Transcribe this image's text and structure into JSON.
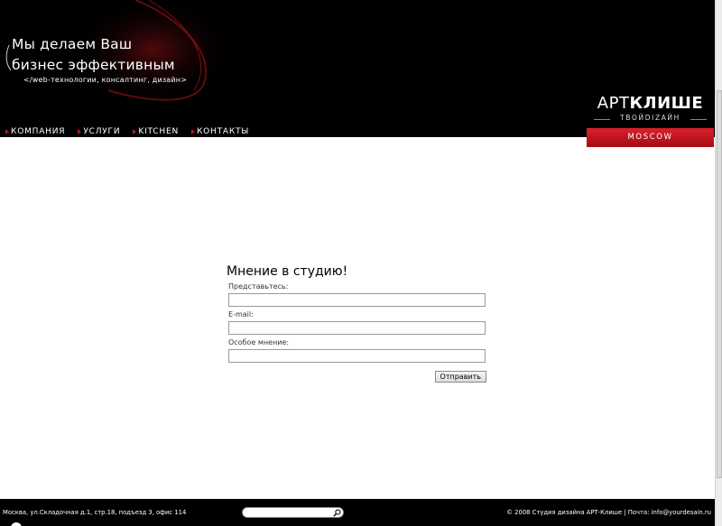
{
  "header": {
    "slogan_line1": "Мы делаем Ваш",
    "slogan_line2": "бизнес эффективным",
    "subslogan": "</web-технологии, консалтинг, дизайн>"
  },
  "nav": {
    "items": [
      {
        "label": "КОМПАНИЯ"
      },
      {
        "label": "УСЛУГИ"
      },
      {
        "label": "KITCHEN"
      },
      {
        "label": "КОНТАКТЫ"
      }
    ]
  },
  "logo": {
    "part1": "АРТ",
    "part2": "КЛИШЕ",
    "sub": "ТВОЙDIZAЙН",
    "city": "MOSCOW"
  },
  "form": {
    "title": "Мнение в студию!",
    "fields": [
      {
        "label": "Представьтесь:",
        "value": ""
      },
      {
        "label": "E-mail:",
        "value": ""
      },
      {
        "label": "Особое мнение:",
        "value": ""
      }
    ],
    "submit_label": "Отправить"
  },
  "footer": {
    "address": "Москва, ул.Складочная д.1, стр.18, подъезд 3, офис 114",
    "copyright": "© 2008 Студия дизайна АРТ-Клише | Почта: info@yourdesain.ru",
    "search_placeholder": ""
  },
  "colors": {
    "header_bg": "#000000",
    "accent_red": "#c4121c",
    "footer_bg": "#000000"
  }
}
